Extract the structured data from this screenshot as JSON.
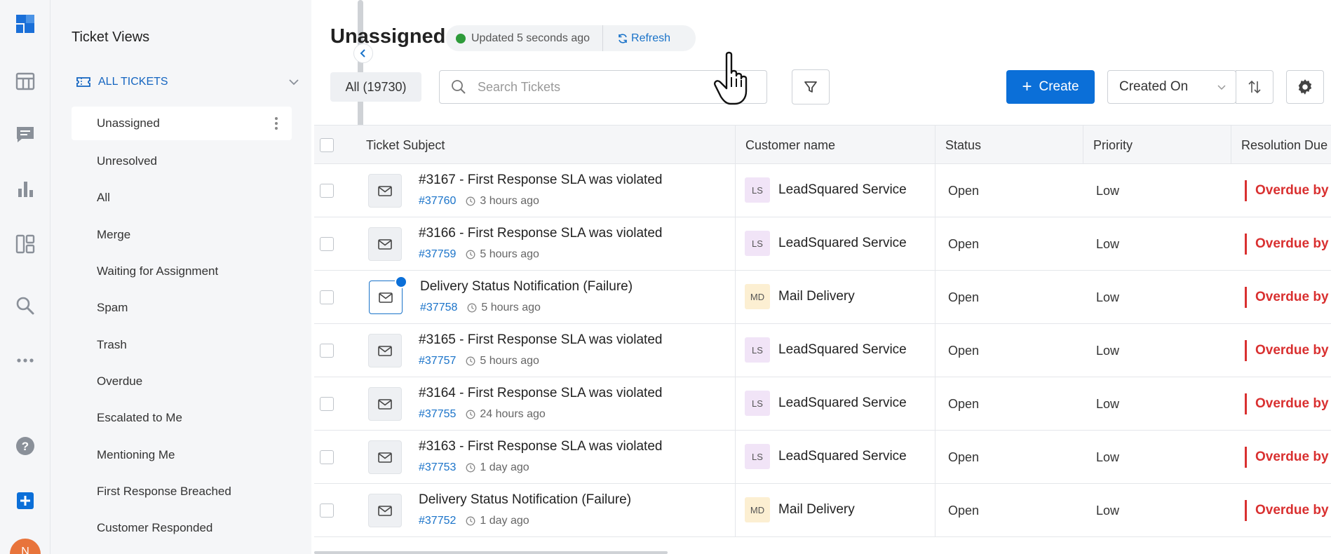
{
  "app": {
    "accent": "#0b6fd8",
    "overdue_color": "#d93030",
    "online_color": "#2e9b3a"
  },
  "rail": {
    "items": [
      "logo-icon",
      "grid-icon",
      "chat-icon",
      "bar-chart-icon",
      "dashboard-icon",
      "search-icon",
      "more-icon",
      "help-icon",
      "add-icon"
    ],
    "avatar_initial": "N"
  },
  "views": {
    "title": "Ticket Views",
    "group_label": "ALL TICKETS",
    "items": [
      {
        "label": "Unassigned",
        "active": true
      },
      {
        "label": "Unresolved"
      },
      {
        "label": "All"
      },
      {
        "label": "Merge"
      },
      {
        "label": "Waiting for Assignment"
      },
      {
        "label": "Spam"
      },
      {
        "label": "Trash"
      },
      {
        "label": "Overdue"
      },
      {
        "label": "Escalated to Me"
      },
      {
        "label": "Mentioning Me"
      },
      {
        "label": "First Response Breached"
      },
      {
        "label": "Customer Responded"
      }
    ]
  },
  "header": {
    "title": "Unassigned",
    "updated_text": "Updated 5 seconds ago",
    "refresh_label": "Refresh"
  },
  "toolbar": {
    "all_count_label": "All (19730)",
    "search_placeholder": "Search Tickets",
    "create_label": "Create",
    "sort_value": "Created On"
  },
  "table": {
    "columns": [
      "Ticket Subject",
      "Customer name",
      "Status",
      "Priority",
      "Resolution Due"
    ],
    "rows": [
      {
        "subject": "#3167 - First Response SLA was violated",
        "id": "#37760",
        "time": "3 hours ago",
        "initials": "LS",
        "customer": "LeadSquared Service",
        "status": "Open",
        "priority": "Low",
        "due": "Overdue by",
        "unread": false
      },
      {
        "subject": "#3166 - First Response SLA was violated",
        "id": "#37759",
        "time": "5 hours ago",
        "initials": "LS",
        "customer": "LeadSquared Service",
        "status": "Open",
        "priority": "Low",
        "due": "Overdue by",
        "unread": false
      },
      {
        "subject": "Delivery Status Notification (Failure)",
        "id": "#37758",
        "time": "5 hours ago",
        "initials": "MD",
        "customer": "Mail Delivery",
        "status": "Open",
        "priority": "Low",
        "due": "Overdue by",
        "unread": true
      },
      {
        "subject": "#3165 - First Response SLA was violated",
        "id": "#37757",
        "time": "5 hours ago",
        "initials": "LS",
        "customer": "LeadSquared Service",
        "status": "Open",
        "priority": "Low",
        "due": "Overdue by",
        "unread": false
      },
      {
        "subject": "#3164 - First Response SLA was violated",
        "id": "#37755",
        "time": "24 hours ago",
        "initials": "LS",
        "customer": "LeadSquared Service",
        "status": "Open",
        "priority": "Low",
        "due": "Overdue by",
        "unread": false
      },
      {
        "subject": "#3163 - First Response SLA was violated",
        "id": "#37753",
        "time": "1 day ago",
        "initials": "LS",
        "customer": "LeadSquared Service",
        "status": "Open",
        "priority": "Low",
        "due": "Overdue by",
        "unread": false
      },
      {
        "subject": "Delivery Status Notification (Failure)",
        "id": "#37752",
        "time": "1 day ago",
        "initials": "MD",
        "customer": "Mail Delivery",
        "status": "Open",
        "priority": "Low",
        "due": "Overdue by",
        "unread": false
      }
    ]
  }
}
